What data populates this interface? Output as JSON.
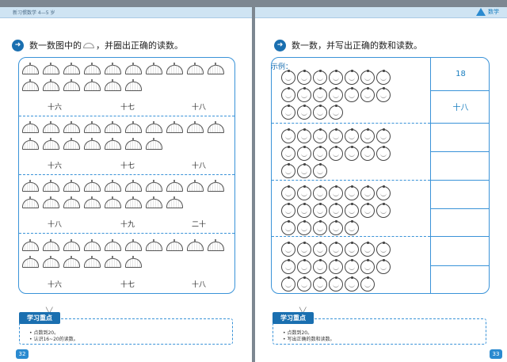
{
  "header": {
    "book_title": "新习惯数学 4—5 岁",
    "subject": "数学"
  },
  "left": {
    "instruction_pre": "数一数图中的",
    "instruction_post": "，并圈出正确的读数。",
    "sections": [
      {
        "row1": 10,
        "row2": 6,
        "options": [
          "十六",
          "十七",
          "十八"
        ]
      },
      {
        "row1": 10,
        "row2": 7,
        "options": [
          "十六",
          "十七",
          "十八"
        ]
      },
      {
        "row1": 10,
        "row2": 8,
        "options": [
          "十八",
          "十九",
          "二十"
        ]
      },
      {
        "row1": 10,
        "row2": 6,
        "options": [
          "十六",
          "十七",
          "十八"
        ]
      }
    ],
    "focus_title": "学习重点",
    "focus_items": [
      "点数到20。",
      "认识16~20的读数。"
    ],
    "page_number": "32"
  },
  "right": {
    "instruction": "数一数，并写出正确的数和读数。",
    "example_label": "示例：",
    "sections": [
      {
        "count": 18,
        "number": "18",
        "reading": "十八"
      },
      {
        "count": 17,
        "number": "",
        "reading": ""
      },
      {
        "count": 19,
        "number": "",
        "reading": ""
      },
      {
        "count": 20,
        "number": "",
        "reading": ""
      }
    ],
    "focus_title": "学习重点",
    "focus_items": [
      "点数到20。",
      "写出正确的数和读数。"
    ],
    "page_number": "33"
  }
}
